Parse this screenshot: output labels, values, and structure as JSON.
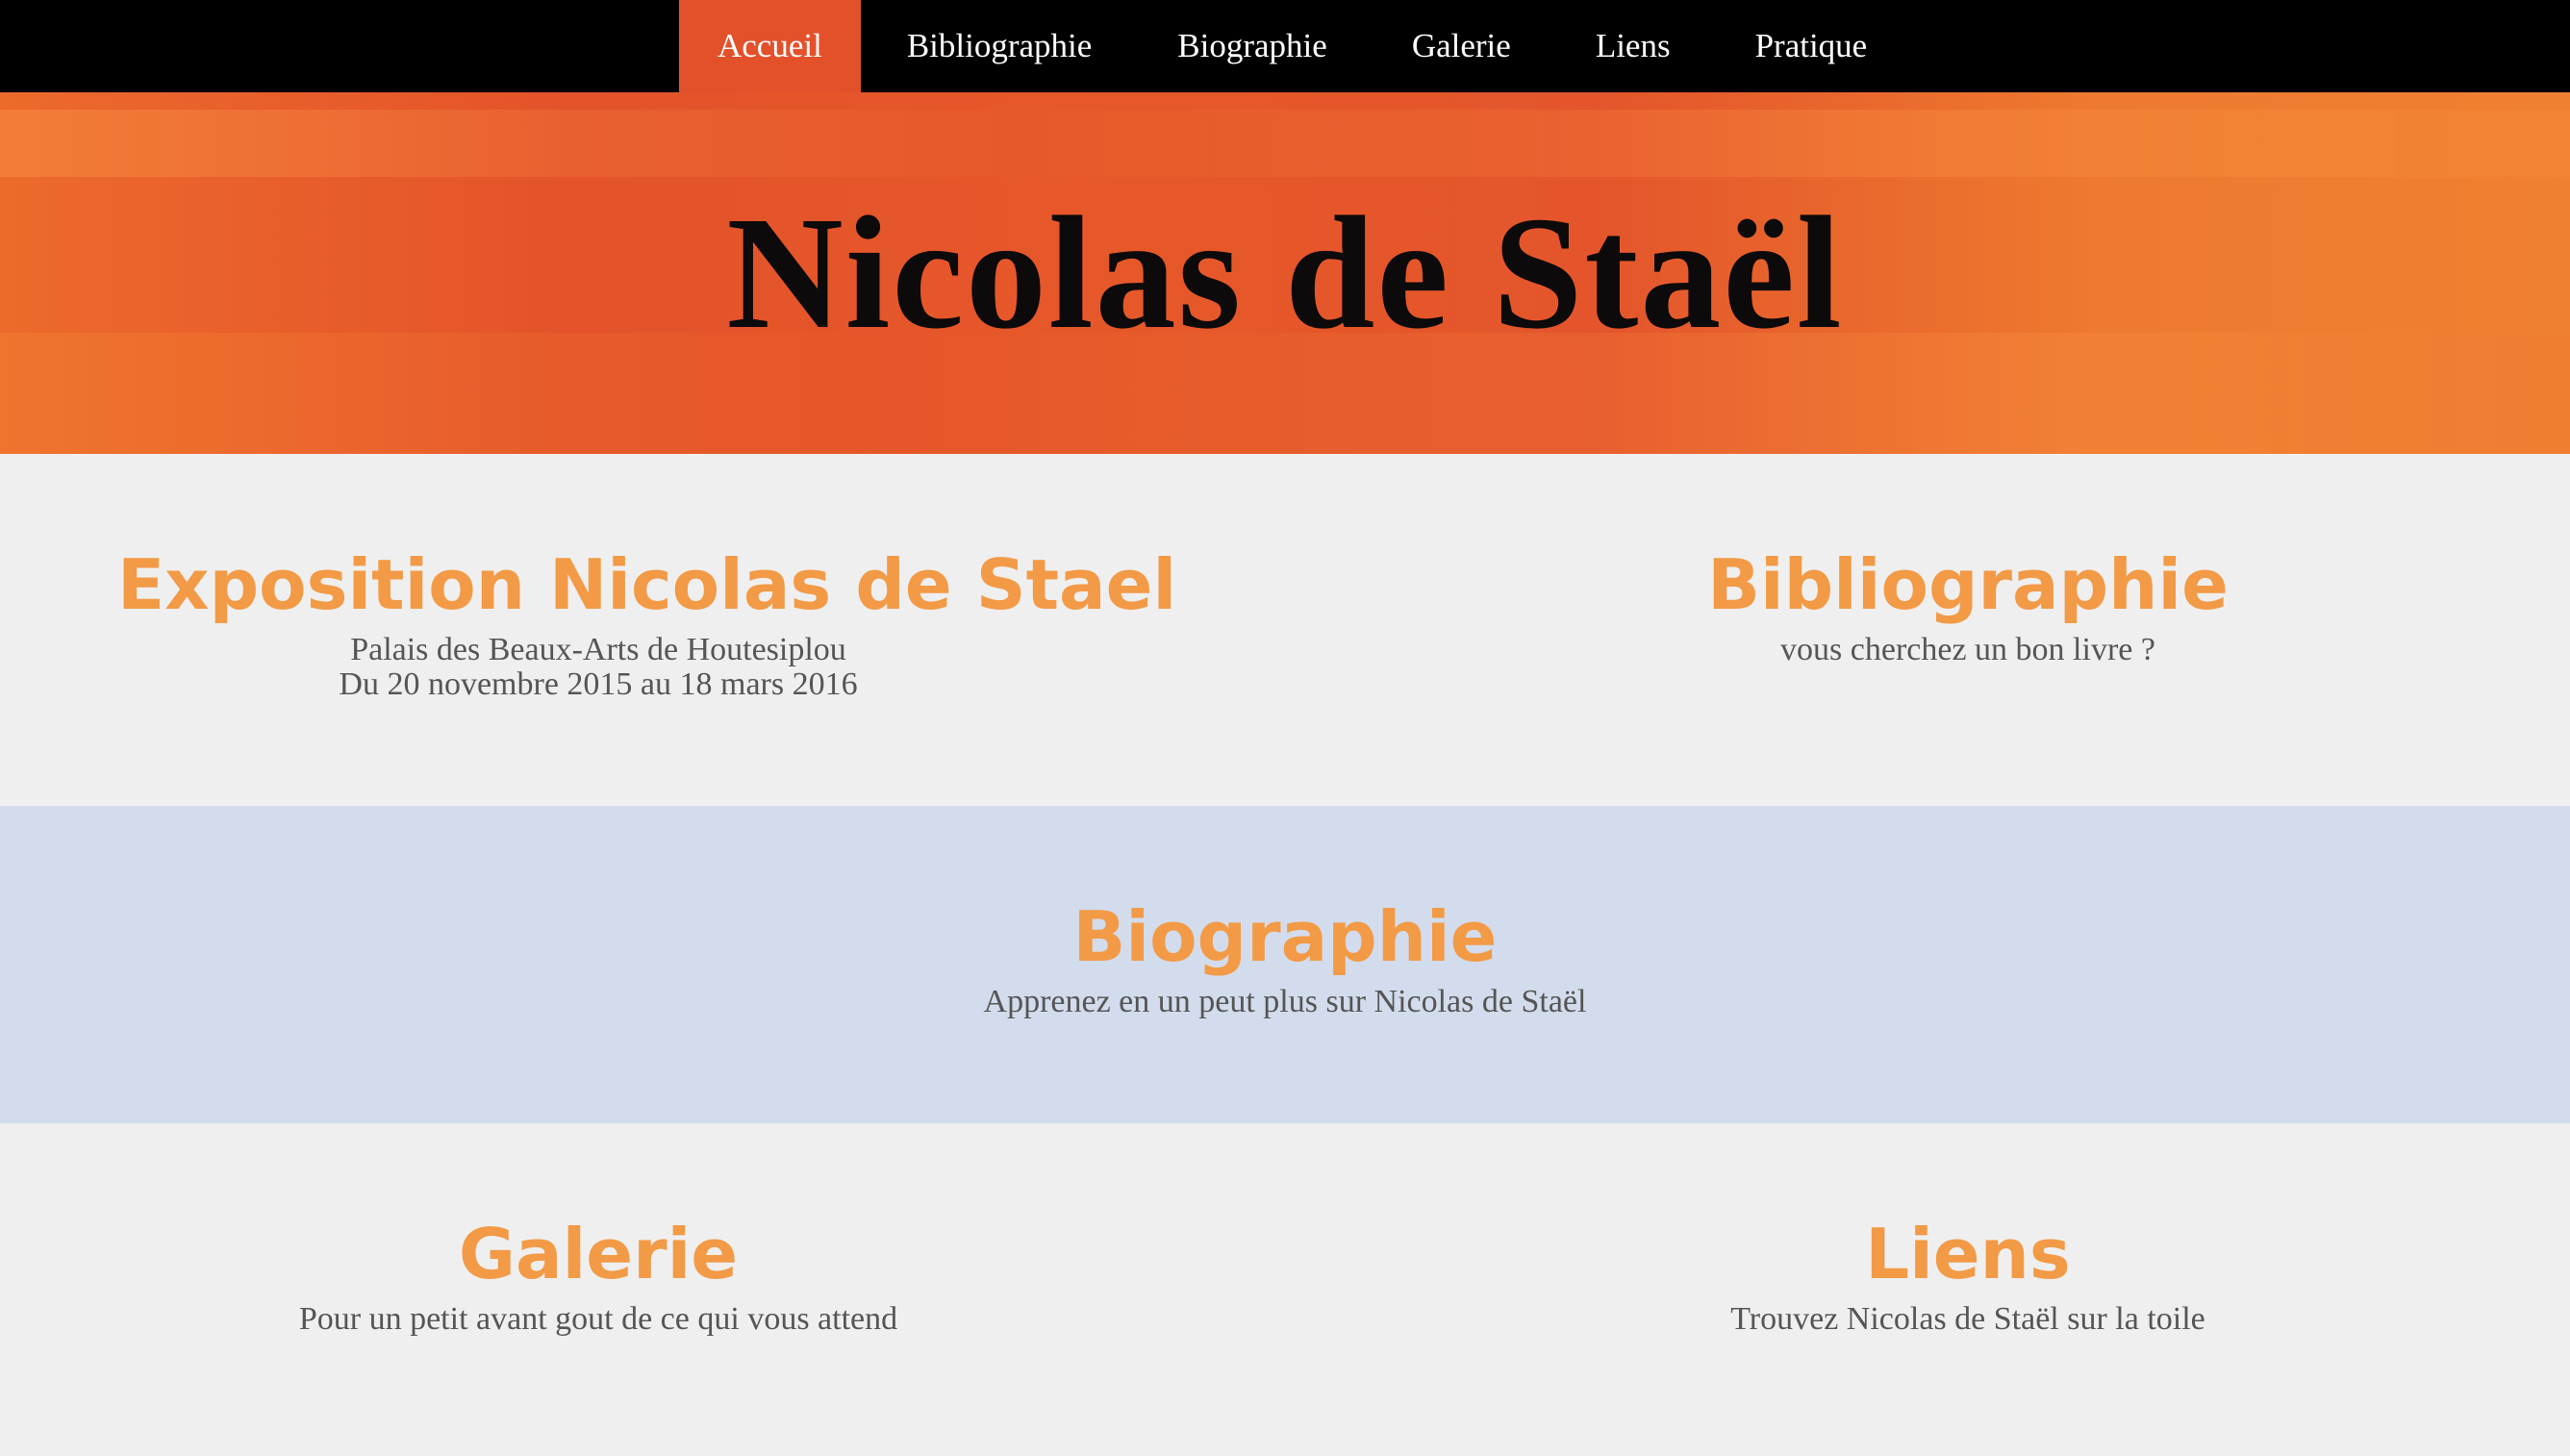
{
  "nav": {
    "items": [
      {
        "label": "Accueil",
        "active": true
      },
      {
        "label": "Bibliographie",
        "active": false
      },
      {
        "label": "Biographie",
        "active": false
      },
      {
        "label": "Galerie",
        "active": false
      },
      {
        "label": "Liens",
        "active": false
      },
      {
        "label": "Pratique",
        "active": false
      }
    ]
  },
  "hero": {
    "title": "Nicolas de Staël"
  },
  "sections": {
    "exposition": {
      "title": "Exposition Nicolas de Stael",
      "line1": "Palais des Beaux-Arts de Houtesiplou",
      "line2": "Du 20 novembre 2015 au 18 mars 2016"
    },
    "bibliographie": {
      "title": "Bibliographie",
      "subtitle": "vous cherchez un bon livre ?"
    },
    "biographie": {
      "title": "Biographie",
      "subtitle": "Apprenez en un peut plus sur Nicolas de Staël"
    },
    "galerie": {
      "title": "Galerie",
      "subtitle": "Pour un petit avant gout de ce qui vous attend"
    },
    "liens": {
      "title": "Liens",
      "subtitle": "Trouvez Nicolas de Staël sur la toile"
    }
  },
  "colors": {
    "nav_bg": "#000000",
    "nav_active": "#e3512b",
    "hero_orange": "#e4532a",
    "heading_orange": "#f29a46",
    "section_blue": "#d3dcec",
    "section_light": "#efefef",
    "body_text": "#555555"
  }
}
